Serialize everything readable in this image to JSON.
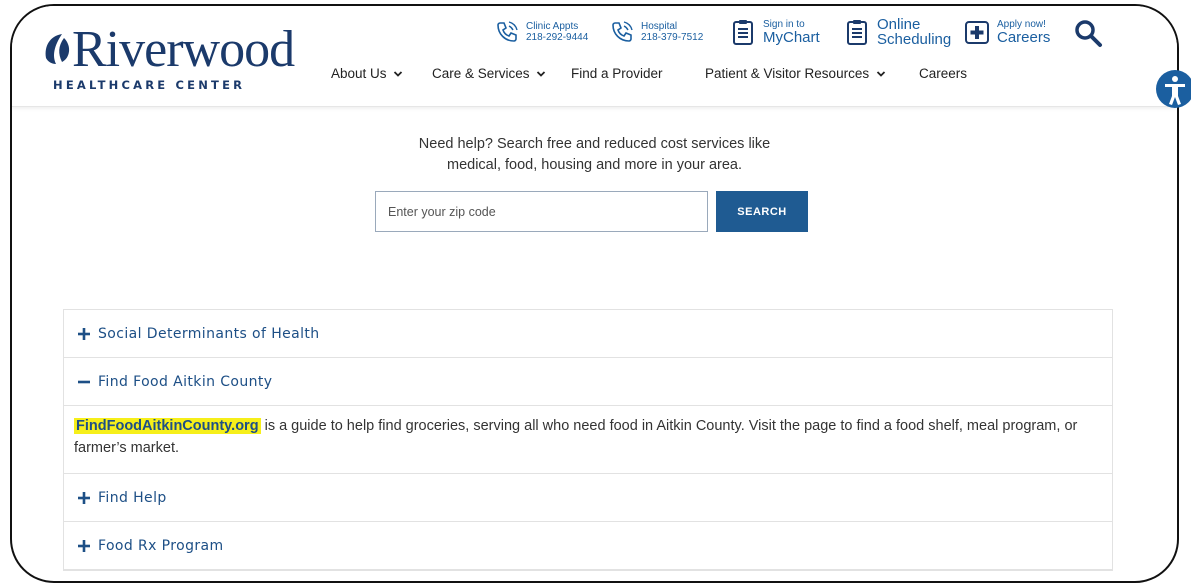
{
  "brand": {
    "name": "Riverwood",
    "subtitle": "HEALTHCARE CENTER",
    "color": "#1b3a6b"
  },
  "utility": {
    "clinic": {
      "label": "Clinic Appts",
      "phone": "218-292-9444"
    },
    "hospital": {
      "label": "Hospital",
      "phone": "218-379-7512"
    },
    "mychart": {
      "top": "Sign in to",
      "label": "MyChart"
    },
    "scheduling": {
      "top": "Online",
      "label": "Scheduling"
    },
    "careers": {
      "top": "Apply now!",
      "label": "Careers"
    },
    "icon_names": [
      "phone-icon",
      "clipboard-icon",
      "plus-box-icon",
      "search-icon"
    ]
  },
  "nav": {
    "items": [
      {
        "label": "About Us",
        "dropdown": true
      },
      {
        "label": "Care & Services",
        "dropdown": true
      },
      {
        "label": "Find a Provider",
        "dropdown": false
      },
      {
        "label": "Patient & Visitor Resources",
        "dropdown": true
      },
      {
        "label": "Careers",
        "dropdown": false
      }
    ]
  },
  "help": {
    "line1": "Need help? Search free and reduced cost services like",
    "line2": "medical, food, housing and more in your area.",
    "placeholder": "Enter your zip code",
    "button": "SEARCH"
  },
  "accordion": {
    "items": [
      {
        "title": "Social Determinants of Health",
        "expanded": false
      },
      {
        "title": "Find Food Aitkin County",
        "expanded": true
      },
      {
        "title": "Find Help",
        "expanded": false
      },
      {
        "title": "Food Rx Program",
        "expanded": false
      }
    ],
    "expanded_body": {
      "link": "FindFoodAitkinCounty.org",
      "text": " is a guide to help find groceries, serving all who need food in Aitkin County. Visit the page to find a food shelf, meal program, or farmer’s market."
    }
  },
  "colors": {
    "accent": "#1f5b92",
    "link": "#1d4f86",
    "highlight": "#f6ef1a",
    "a11y": "#1b5fa0"
  }
}
